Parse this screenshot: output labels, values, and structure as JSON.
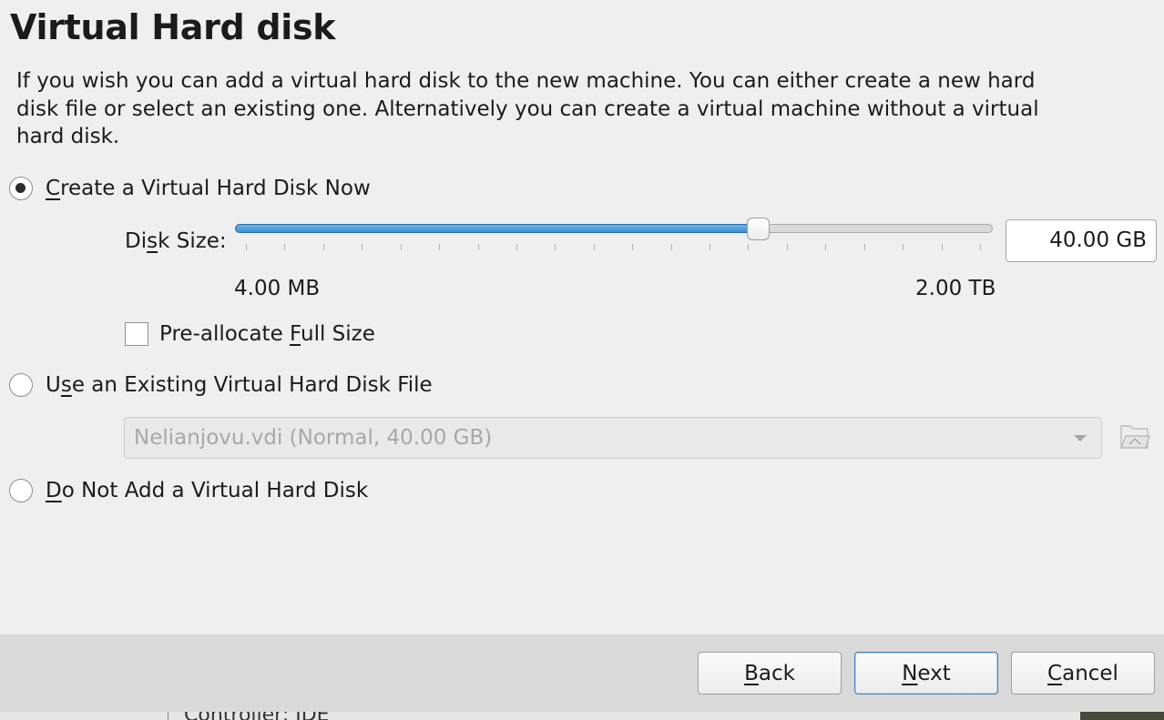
{
  "dialog": {
    "title": "Virtual Hard disk",
    "description": "If you wish you can add a virtual hard disk to the new machine. You can either create a new hard disk file or select an existing one. Alternatively you can create a virtual machine without a virtual hard disk."
  },
  "options": {
    "create_new": {
      "pre": "",
      "mnemonic": "C",
      "post": "reate a Virtual Hard Disk Now",
      "selected": true
    },
    "use_existing": {
      "pre": "U",
      "mnemonic": "s",
      "post": "e an Existing Virtual Hard Disk File",
      "selected": false
    },
    "do_not_add": {
      "pre": "",
      "mnemonic": "D",
      "post": "o Not Add a Virtual Hard Disk",
      "selected": false
    }
  },
  "disk_size": {
    "label_pre": "Di",
    "label_mnemonic": "s",
    "label_post": "k Size:",
    "value": "40.00 GB",
    "min_label": "4.00 MB",
    "max_label": "2.00 TB",
    "slider_fraction": 0.69,
    "tick_count": 20
  },
  "preallocate": {
    "pre": "Pre-allocate ",
    "mnemonic": "F",
    "post": "ull Size",
    "checked": false
  },
  "existing_file": {
    "selected": "Nelianjovu.vdi (Normal, 40.00 GB)"
  },
  "buttons": {
    "back": {
      "mnemonic": "B",
      "post": "ack"
    },
    "next": {
      "mnemonic": "N",
      "post": "ext"
    },
    "cancel": {
      "mnemonic": "C",
      "post": "ancel"
    }
  },
  "background": {
    "partial_text": "Controller: IDE"
  },
  "colors": {
    "accent": "#3f8fd4",
    "background": "#efefef",
    "button_bar": "#d9d9d9"
  }
}
